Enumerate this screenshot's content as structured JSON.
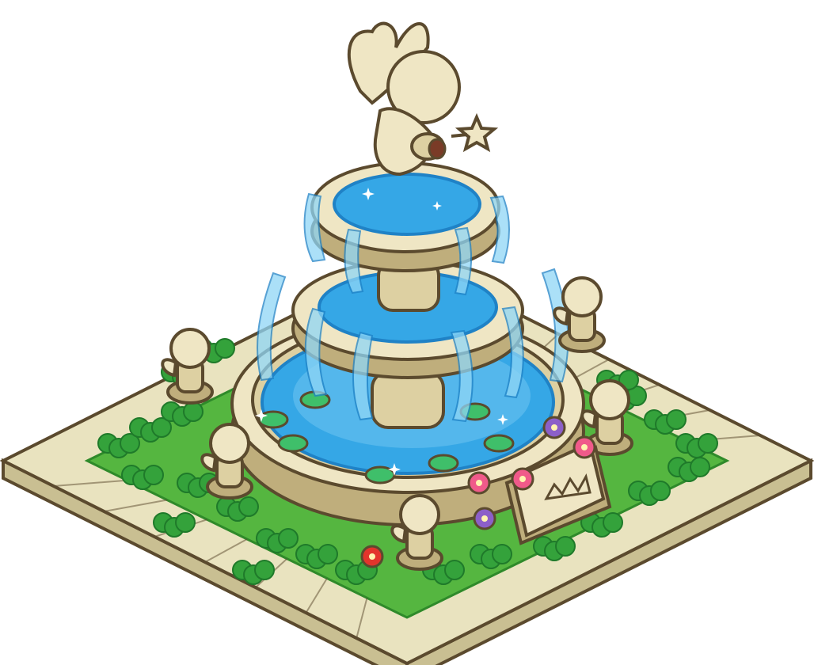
{
  "sprite": {
    "kind": "isometric fountain decoration",
    "visible_text": []
  },
  "elements": {
    "tiles": "stone-paving-tile",
    "hedge": "clover-hedge",
    "basin": "fountain-basin",
    "statue": "winged-cherub-statue",
    "plaque": "stone-plaque"
  },
  "palette": {
    "outline": "#5b4a2e",
    "stone_light": "#efe6c4",
    "stone_mid": "#ddd0a2",
    "stone_shadow": "#bfae7c",
    "tile": "#e9e3bf",
    "tile_side": "#c9bf92",
    "grass": "#55b640",
    "grass_dark": "#2f8a2a",
    "hedge": "#34a23b",
    "hedge_dark": "#1f7a2a",
    "water": "#35a7e6",
    "water_light": "#8fd6f6",
    "water_deep": "#1f82c6",
    "lily_pad": "#3fbf6a",
    "flower_pink": "#f05a8a",
    "flower_purple": "#8c5fc8",
    "flower_red": "#e3342c",
    "sparkle": "#ffffff"
  }
}
